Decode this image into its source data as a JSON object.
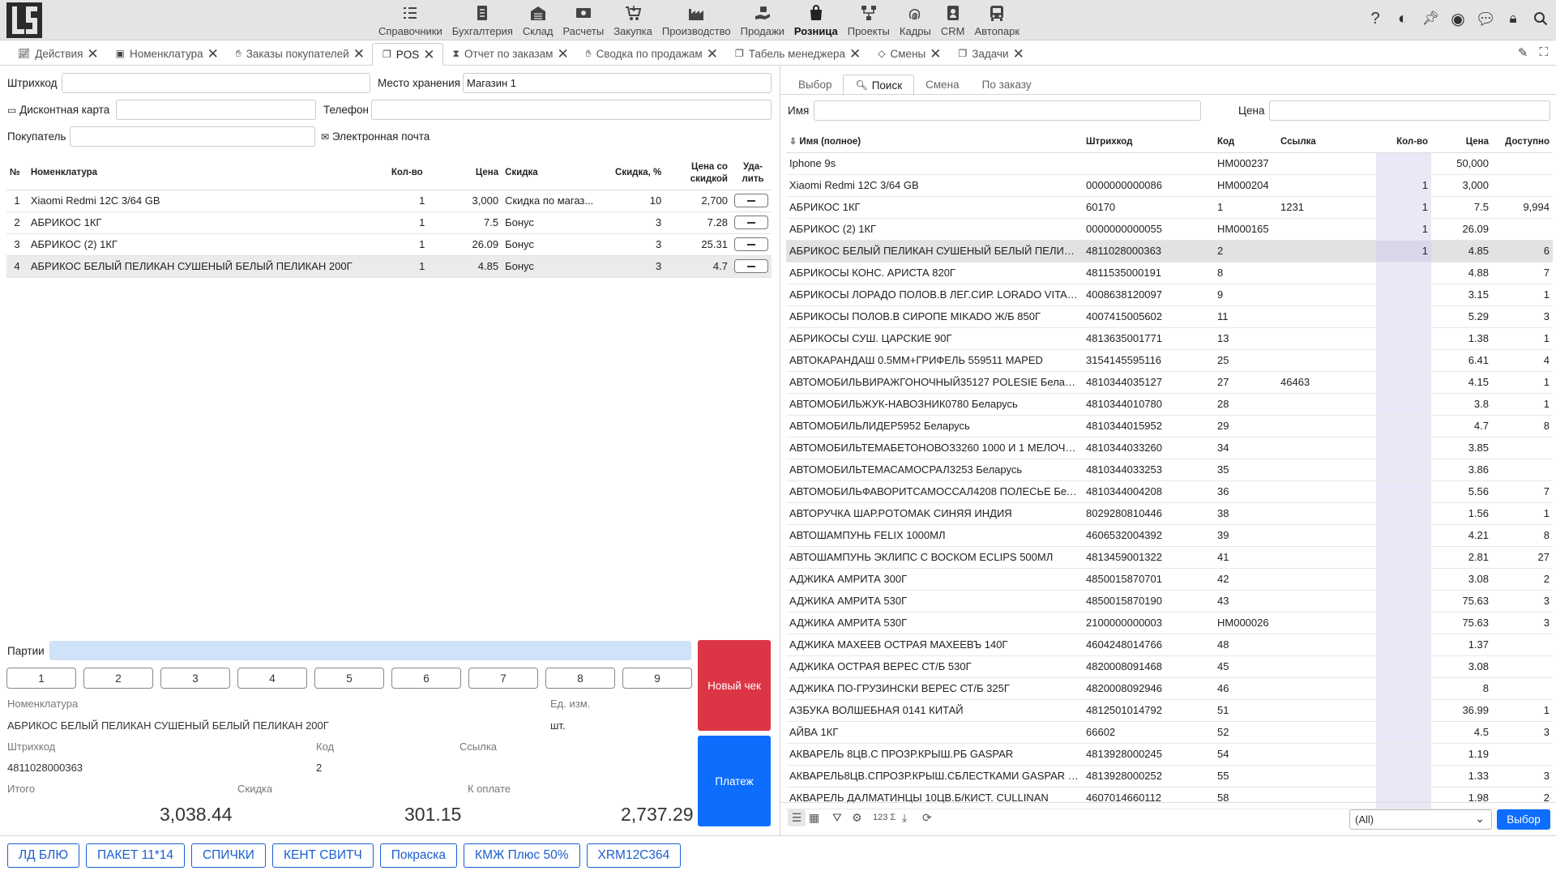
{
  "nav": [
    {
      "label": "Справочники",
      "icon": "list-icon"
    },
    {
      "label": "Бухгалтерия",
      "icon": "ledger-icon"
    },
    {
      "label": "Склад",
      "icon": "warehouse-icon"
    },
    {
      "label": "Расчеты",
      "icon": "money-icon"
    },
    {
      "label": "Закупка",
      "icon": "cart-down-icon"
    },
    {
      "label": "Производство",
      "icon": "factory-icon"
    },
    {
      "label": "Продажи",
      "icon": "hand-money-icon"
    },
    {
      "label": "Розница",
      "icon": "shopping-bag-icon",
      "active": true
    },
    {
      "label": "Проекты",
      "icon": "project-icon"
    },
    {
      "label": "Кадры",
      "icon": "fingerprint-icon"
    },
    {
      "label": "CRM",
      "icon": "crm-icon"
    },
    {
      "label": "Автопарк",
      "icon": "bus-icon"
    }
  ],
  "tabs": [
    {
      "label": "Действия",
      "icon": "chart-icon"
    },
    {
      "label": "Номенклатура",
      "icon": "box-icon"
    },
    {
      "label": "Заказы покупателей",
      "icon": "hand-icon"
    },
    {
      "label": "POS",
      "icon": "copy-icon",
      "active": true
    },
    {
      "label": "Отчет по заказам",
      "icon": "hourglass-icon"
    },
    {
      "label": "Сводка по продажам",
      "icon": "hand-icon"
    },
    {
      "label": "Табель менеджера",
      "icon": "copy-icon"
    },
    {
      "label": "Смены",
      "icon": "shift-icon"
    },
    {
      "label": "Задачи",
      "icon": "copy-icon"
    }
  ],
  "form": {
    "barcode_label": "Штрихкод",
    "barcode_value": "",
    "storage_label": "Место хранения",
    "storage_value": "Магазин 1",
    "card_label": "Дисконтная карта",
    "card_value": "",
    "phone_label": "Телефон",
    "phone_value": "",
    "buyer_label": "Покупатель",
    "buyer_value": "",
    "email_label": "Электронная почта"
  },
  "cart": {
    "headers": {
      "num": "№",
      "name": "Номенклатура",
      "qty": "Кол-во",
      "price": "Цена",
      "discount": "Скидка",
      "discount_pct": "Скидка, %",
      "price_disc": "Цена со скидкой",
      "del": "Уда-лить"
    },
    "rows": [
      {
        "num": "1",
        "name": "Xiaomi Redmi 12C 3/64 GB",
        "qty": "1",
        "price": "3,000",
        "discount": "Скидка по магаз...",
        "pct": "10",
        "final": "2,700"
      },
      {
        "num": "2",
        "name": "АБРИКОС 1КГ",
        "qty": "1",
        "price": "7.5",
        "discount": "Бонус",
        "pct": "3",
        "final": "7.28"
      },
      {
        "num": "3",
        "name": "АБРИКОС (2) 1КГ",
        "qty": "1",
        "price": "26.09",
        "discount": "Бонус",
        "pct": "3",
        "final": "25.31"
      },
      {
        "num": "4",
        "name": "АБРИКОС БЕЛЫЙ ПЕЛИКАН СУШЕНЫЙ БЕЛЫЙ ПЕЛИКАН 200Г",
        "qty": "1",
        "price": "4.85",
        "discount": "Бонус",
        "pct": "3",
        "final": "4.7",
        "selected": true
      }
    ]
  },
  "batches_label": "Партии",
  "numpad": [
    "1",
    "2",
    "3",
    "4",
    "5",
    "6",
    "7",
    "8",
    "9"
  ],
  "new_check_label": "Новый чек",
  "pay_label": "Платеж",
  "details": {
    "item_label": "Номенклатура",
    "item_value": "АБРИКОС БЕЛЫЙ ПЕЛИКАН СУШЕНЫЙ БЕЛЫЙ ПЕЛИКАН 200Г",
    "unit_label": "Ед. изм.",
    "unit_value": "шт.",
    "barcode_label": "Штрихкод",
    "barcode_value": "4811028000363",
    "code_label": "Код",
    "code_value": "2",
    "link_label": "Ссылка",
    "link_value": "",
    "total_label": "Итого",
    "total_value": "3,038.44",
    "discount_label": "Скидка",
    "discount_value": "301.15",
    "topay_label": "К оплате",
    "topay_value": "2,737.29"
  },
  "right_tabs": [
    {
      "label": "Выбор"
    },
    {
      "label": "Поиск",
      "active": true
    },
    {
      "label": "Смена"
    },
    {
      "label": "По заказу"
    }
  ],
  "search": {
    "name_label": "Имя",
    "name_value": "",
    "price_label": "Цена",
    "price_value": ""
  },
  "catalog": {
    "headers": {
      "name": "Имя (полное)",
      "barcode": "Штрихкод",
      "code": "Код",
      "link": "Ссылка",
      "qty": "Кол-во",
      "price": "Цена",
      "avail": "Доступно"
    },
    "rows": [
      {
        "name": "Iphone 9s",
        "barcode": "",
        "code": "HM000237",
        "link": "",
        "qty": "",
        "price": "50,000",
        "avail": ""
      },
      {
        "name": "Xiaomi Redmi 12C 3/64 GB",
        "barcode": "0000000000086",
        "code": "HM000204",
        "link": "",
        "qty": "1",
        "price": "3,000",
        "avail": ""
      },
      {
        "name": "АБРИКОС 1КГ",
        "barcode": "60170",
        "code": "1",
        "link": "1231",
        "qty": "1",
        "price": "7.5",
        "avail": "9,994"
      },
      {
        "name": "АБРИКОС (2) 1КГ",
        "barcode": "0000000000055",
        "code": "HM000165",
        "link": "",
        "qty": "1",
        "price": "26.09",
        "avail": ""
      },
      {
        "name": "АБРИКОС БЕЛЫЙ ПЕЛИКАН СУШЕНЫЙ БЕЛЫЙ ПЕЛИКАН ...",
        "barcode": "4811028000363",
        "code": "2",
        "link": "",
        "qty": "1",
        "price": "4.85",
        "avail": "6",
        "selected": true
      },
      {
        "name": "АБРИКОСЫ КОНС. АРИСТА 820Г",
        "barcode": "4811535000191",
        "code": "8",
        "link": "",
        "qty": "",
        "price": "4.88",
        "avail": "7"
      },
      {
        "name": "АБРИКОСЫ ЛОРАДО ПОЛОВ.В ЛЕГ.СИР. LORADO VITALAN...",
        "barcode": "4008638120097",
        "code": "9",
        "link": "",
        "qty": "",
        "price": "3.15",
        "avail": "1"
      },
      {
        "name": "АБРИКОСЫ ПОЛОВ.В СИРОПЕ MIKADO Ж/Б 850Г",
        "barcode": "4007415005602",
        "code": "11",
        "link": "",
        "qty": "",
        "price": "5.29",
        "avail": "3"
      },
      {
        "name": "АБРИКОСЫ СУШ. ЦАРСКИЕ 90Г",
        "barcode": "4813635001771",
        "code": "13",
        "link": "",
        "qty": "",
        "price": "1.38",
        "avail": "1"
      },
      {
        "name": "АВТОКАРАНДАШ 0.5ММ+ГРИФЕЛЬ 559511 MAPED",
        "barcode": "3154145595116",
        "code": "25",
        "link": "",
        "qty": "",
        "price": "6.41",
        "avail": "4"
      },
      {
        "name": "АВТОМОБИЛЬВИРАЖГОНОЧНЫЙ35127 POLESIE Беларусь",
        "barcode": "4810344035127",
        "code": "27",
        "link": "46463",
        "qty": "",
        "price": "4.15",
        "avail": "1"
      },
      {
        "name": "АВТОМОБИЛЬЖУК-НАВОЗНИК0780 Беларусь",
        "barcode": "4810344010780",
        "code": "28",
        "link": "",
        "qty": "",
        "price": "3.8",
        "avail": "1"
      },
      {
        "name": "АВТОМОБИЛЬЛИДЕР5952 Беларусь",
        "barcode": "4810344015952",
        "code": "29",
        "link": "",
        "qty": "",
        "price": "4.7",
        "avail": "8"
      },
      {
        "name": "АВТОМОБИЛЬТЕМАБЕТОНОВОЗ3260 1000 И 1 МЕЛОЧЬ Б...",
        "barcode": "4810344033260",
        "code": "34",
        "link": "",
        "qty": "",
        "price": "3.85",
        "avail": ""
      },
      {
        "name": "АВТОМОБИЛЬТЕМАСАМОСРАЛ3253 Беларусь",
        "barcode": "4810344033253",
        "code": "35",
        "link": "",
        "qty": "",
        "price": "3.86",
        "avail": ""
      },
      {
        "name": "АВТОМОБИЛЬФАВОРИТСАМОССАЛ4208 ПОЛЕСЬЕ Белар...",
        "barcode": "4810344004208",
        "code": "36",
        "link": "",
        "qty": "",
        "price": "5.56",
        "avail": "7"
      },
      {
        "name": "АВТОРУЧКА ШАР.POTOMAK СИНЯЯ ИНДИЯ",
        "barcode": "8029280810446",
        "code": "38",
        "link": "",
        "qty": "",
        "price": "1.56",
        "avail": "1"
      },
      {
        "name": "АВТОШАМПУНЬ FELIX 1000МЛ",
        "barcode": "4606532004392",
        "code": "39",
        "link": "",
        "qty": "",
        "price": "4.21",
        "avail": "8"
      },
      {
        "name": "АВТОШАМПУНЬ ЭКЛИПС С ВОСКОМ ECLIPS 500МЛ",
        "barcode": "4813459001322",
        "code": "41",
        "link": "",
        "qty": "",
        "price": "2.81",
        "avail": "27"
      },
      {
        "name": "АДЖИКА АМРИТА 300Г",
        "barcode": "4850015870701",
        "code": "42",
        "link": "",
        "qty": "",
        "price": "3.08",
        "avail": "2"
      },
      {
        "name": "АДЖИКА АМРИТА 530Г",
        "barcode": "4850015870190",
        "code": "43",
        "link": "",
        "qty": "",
        "price": "75.63",
        "avail": "3"
      },
      {
        "name": "АДЖИКА АМРИТА 530Г",
        "barcode": "2100000000003",
        "code": "HM000026",
        "link": "",
        "qty": "",
        "price": "75.63",
        "avail": "3"
      },
      {
        "name": "АДЖИКА МАХЕЕВ ОСТРАЯ МАХЕЕВЪ 140Г",
        "barcode": "4604248014766",
        "code": "48",
        "link": "",
        "qty": "",
        "price": "1.37",
        "avail": ""
      },
      {
        "name": "АДЖИКА ОСТРАЯ ВЕРЕС СТ/Б 530Г",
        "barcode": "4820008091468",
        "code": "45",
        "link": "",
        "qty": "",
        "price": "3.08",
        "avail": ""
      },
      {
        "name": "АДЖИКА ПО-ГРУЗИНСКИ ВЕРЕС СТ/Б 325Г",
        "barcode": "4820008092946",
        "code": "46",
        "link": "",
        "qty": "",
        "price": "8",
        "avail": ""
      },
      {
        "name": "АЗБУКА ВОЛШЕБНАЯ 0141 КИТАЙ",
        "barcode": "4812501014792",
        "code": "51",
        "link": "",
        "qty": "",
        "price": "36.99",
        "avail": "1"
      },
      {
        "name": "АЙВА 1КГ",
        "barcode": "66602",
        "code": "52",
        "link": "",
        "qty": "",
        "price": "4.5",
        "avail": "3"
      },
      {
        "name": "АКВАРЕЛЬ 8ЦВ.С ПРОЗР.КРЫШ.РБ GASPAR",
        "barcode": "4813928000245",
        "code": "54",
        "link": "",
        "qty": "",
        "price": "1.19",
        "avail": ""
      },
      {
        "name": "АКВАРЕЛЬ8ЦВ.СПРОЗР.КРЫШ.СБЛЕСТКАМИ GASPAR Бела...",
        "barcode": "4813928000252",
        "code": "55",
        "link": "",
        "qty": "",
        "price": "1.33",
        "avail": "3"
      },
      {
        "name": "АКВАРЕЛЬ ДАЛМАТИНЦЫ 10ЦВ.Б/КИСТ. CULLINAN",
        "barcode": "4607014660112",
        "code": "58",
        "link": "",
        "qty": "",
        "price": "1.98",
        "avail": "2"
      }
    ]
  },
  "filter_value": "(All)",
  "select_label": "Выбор",
  "quick_buttons": [
    "ЛД БЛЮ",
    "ПАКЕТ 11*14",
    "СПИЧКИ",
    "КЕНТ СВИТЧ",
    "Покраска",
    "КМЖ Плюс 50%",
    "XRM12C364"
  ],
  "colors": {
    "new_check": "#dc3545",
    "pay": "#0d6efd",
    "accent": "#1a5fcf",
    "qty_col": "#e9e8f6",
    "batch_bar": "#cfe2f7"
  }
}
